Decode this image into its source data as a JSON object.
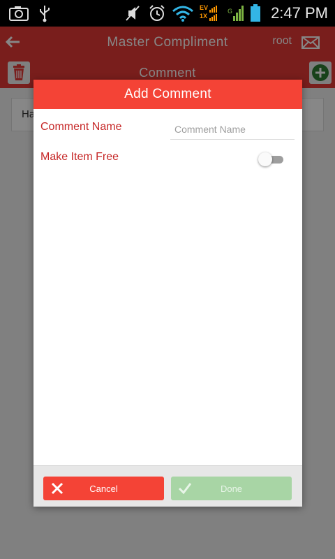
{
  "status_bar": {
    "time": "2:47 PM",
    "icons": [
      "camera-icon",
      "usb-icon",
      "mute-icon",
      "alarm-icon",
      "wifi-icon",
      "ev-dual-signal-icon",
      "signal-icon",
      "battery-icon"
    ],
    "network_top": "EV",
    "network_bottom": "1X"
  },
  "app_bar": {
    "title": "Master Compliment",
    "user": "root",
    "icons": [
      "back-arrow-icon",
      "mail-icon"
    ]
  },
  "sub_bar": {
    "title": "Comment",
    "icons": [
      "trash-icon",
      "add-circle-icon"
    ]
  },
  "list": {
    "items": [
      {
        "label": "Ha"
      }
    ]
  },
  "dialog": {
    "title": "Add Comment",
    "comment_name_label": "Comment Name",
    "comment_name_placeholder": "Comment Name",
    "comment_name_value": "",
    "make_item_free_label": "Make Item Free",
    "make_item_free_on": false,
    "cancel_label": "Cancel",
    "done_label": "Done",
    "colors": {
      "header": "#f44336",
      "label": "#c62828",
      "cancel": "#f44336",
      "done_disabled": "#a8d5a5"
    }
  }
}
